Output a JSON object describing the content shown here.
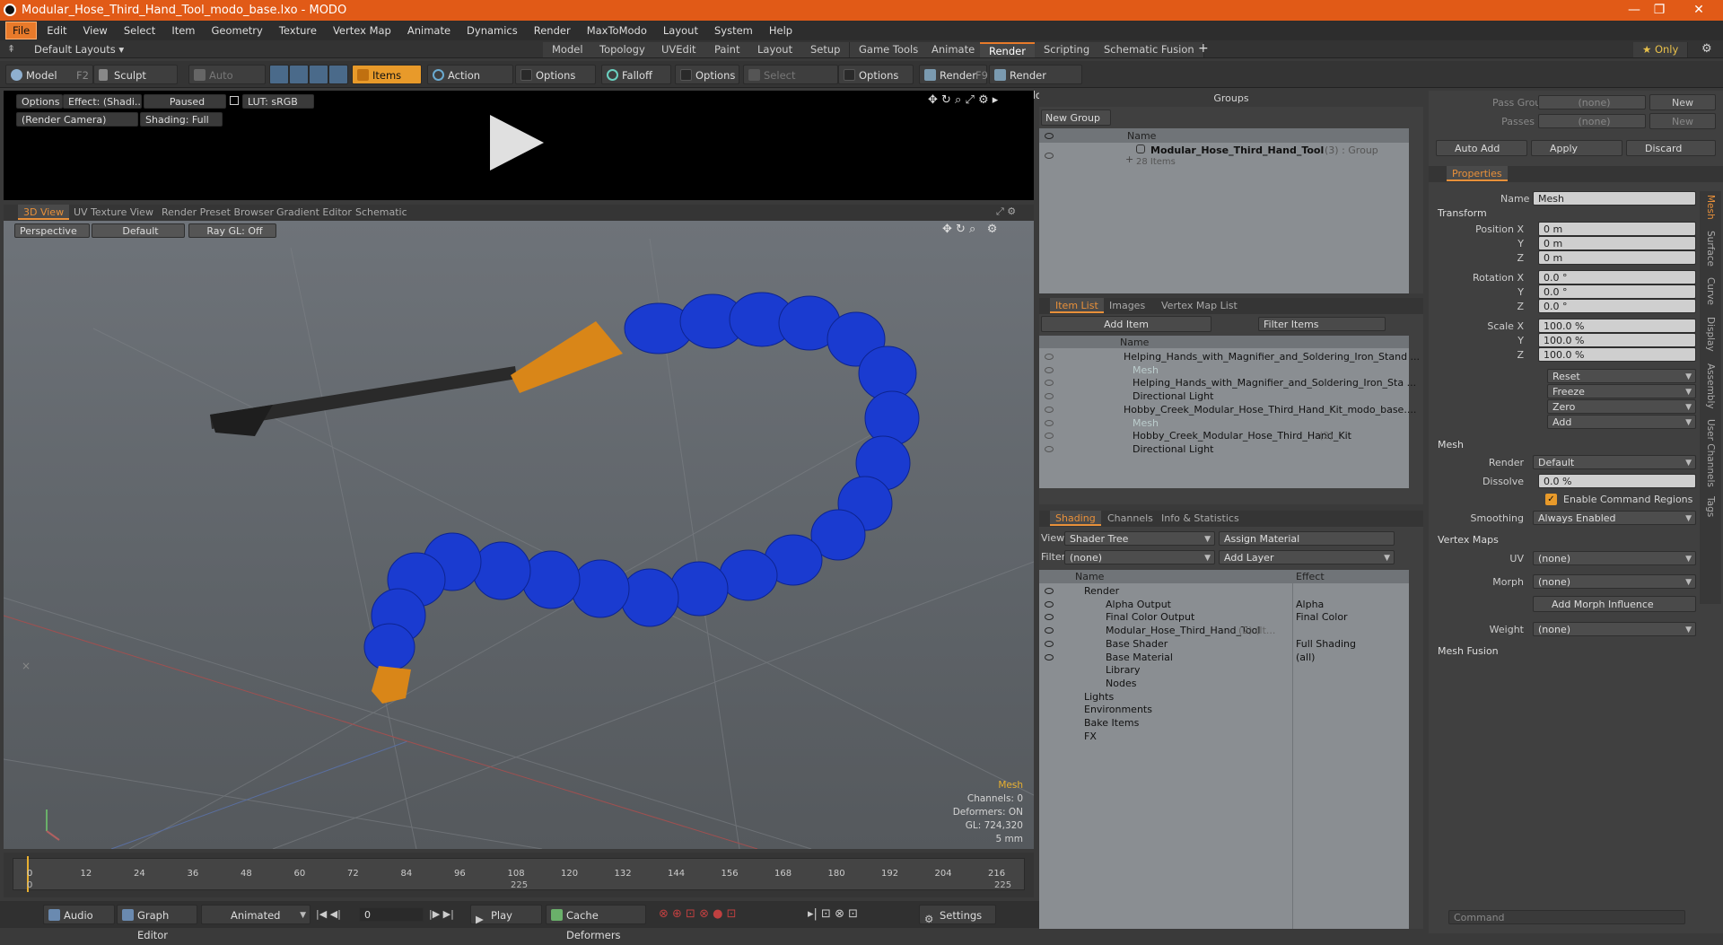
{
  "window": {
    "title": "Modular_Hose_Third_Hand_Tool_modo_base.lxo - MODO",
    "min": "—",
    "max": "❐",
    "close": "✕"
  },
  "menu": [
    "File",
    "Edit",
    "View",
    "Select",
    "Item",
    "Geometry",
    "Texture",
    "Vertex Map",
    "Animate",
    "Dynamics",
    "Render",
    "MaxToModo",
    "Layout",
    "System",
    "Help"
  ],
  "layouts": {
    "label": "Default Layouts ▾",
    "tabs": [
      "Model",
      "Topology",
      "UVEdit",
      "Paint",
      "Layout",
      "Setup",
      "Game Tools",
      "Animate",
      "Render",
      "Scripting",
      "Schematic Fusion"
    ],
    "selected": "Render",
    "plus": "+",
    "only": "★  Only"
  },
  "toolbar": {
    "model": "Model",
    "model_key": "F2",
    "sculpt": "Sculpt",
    "auto_select": "Auto Select",
    "items": "Items",
    "action_center": "Action Center",
    "options1": "Options",
    "falloff": "Falloff",
    "options2": "Options",
    "select_through": "Select Through",
    "options3": "Options",
    "render": "Render",
    "render_key": "F9",
    "render_window": "Render Window"
  },
  "preview": {
    "options": "Options",
    "effect": "Effect: (Shadi...",
    "paused": "Paused",
    "lut": "LUT: sRGB",
    "camera": "(Render Camera)",
    "shading": "Shading: Full"
  },
  "viewport_tabs": [
    "3D View",
    "UV Texture View",
    "Render Preset Browser",
    "Gradient Editor",
    "Schematic"
  ],
  "viewport": {
    "perspective": "Perspective",
    "default": "Default",
    "raygl": "Ray GL: Off",
    "info": [
      "Mesh",
      "Channels: 0",
      "Deformers: ON",
      "GL: 724,320",
      "5 mm"
    ]
  },
  "timeline": {
    "ticks": [
      "0",
      "12",
      "24",
      "36",
      "48",
      "60",
      "72",
      "84",
      "96",
      "108",
      "120",
      "132",
      "144",
      "156",
      "168",
      "180",
      "192",
      "204",
      "216"
    ],
    "sub_start": "0",
    "sub_mid": "225",
    "sub_end": "225"
  },
  "bottombar": {
    "audio": "Audio",
    "graph_editor": "Graph Editor",
    "animated": "Animated",
    "frame": "0",
    "play": "Play",
    "cache": "Cache Deformers",
    "settings": "Settings"
  },
  "groups": {
    "title": "Groups",
    "new_group": "New Group",
    "col_name": "Name",
    "item_name": "Modular_Hose_Third_Hand_Tool",
    "item_count": "(3) : Group",
    "item_sub": "28 Items"
  },
  "itemlist": {
    "tabs": [
      "Item List",
      "Images",
      "Vertex Map List"
    ],
    "add_item": "Add Item",
    "filter": "Filter Items",
    "col_name": "Name",
    "rows": [
      {
        "label": "Helping_Hands_with_Magnifier_and_Soldering_Iron_Stand ...",
        "indent": 0,
        "dim": false
      },
      {
        "label": "Mesh",
        "indent": 1,
        "dim": true
      },
      {
        "label": "Helping_Hands_with_Magnifier_and_Soldering_Iron_Sta ...",
        "indent": 1,
        "dim": false
      },
      {
        "label": "Directional Light",
        "indent": 1,
        "dim": false
      },
      {
        "label": "Hobby_Creek_Modular_Hose_Third_Hand_Kit_modo_base....",
        "indent": 0,
        "dim": false
      },
      {
        "label": "Mesh",
        "indent": 1,
        "dim": true
      },
      {
        "label": "Hobby_Creek_Modular_Hose_Third_Hand_Kit",
        "indent": 1,
        "dim": false,
        "count": "(2)"
      },
      {
        "label": "Directional Light",
        "indent": 1,
        "dim": false
      }
    ]
  },
  "shading": {
    "tabs": [
      "Shading",
      "Channels",
      "Info & Statistics"
    ],
    "view_label": "View",
    "view": "Shader Tree",
    "assign": "Assign Material",
    "filter_label": "Filter",
    "filter": "(none)",
    "add_layer": "Add Layer",
    "col_name": "Name",
    "col_effect": "Effect",
    "rows": [
      {
        "name": "Render",
        "effect": "",
        "indent": 0
      },
      {
        "name": "Alpha Output",
        "effect": "Alpha",
        "indent": 1
      },
      {
        "name": "Final Color Output",
        "effect": "Final Color",
        "indent": 1
      },
      {
        "name": "Modular_Hose_Third_Hand_Tool",
        "effect": "",
        "indent": 1,
        "count": "(2) (It..."
      },
      {
        "name": "Base Shader",
        "effect": "Full Shading",
        "indent": 1
      },
      {
        "name": "Base Material",
        "effect": "(all)",
        "indent": 1
      },
      {
        "name": "Library",
        "effect": "",
        "indent": 1
      },
      {
        "name": "Nodes",
        "effect": "",
        "indent": 1
      },
      {
        "name": "Lights",
        "effect": "",
        "indent": 0
      },
      {
        "name": "Environments",
        "effect": "",
        "indent": 0
      },
      {
        "name": "Bake Items",
        "effect": "",
        "indent": 0
      },
      {
        "name": "FX",
        "effect": "",
        "indent": 0
      }
    ]
  },
  "props": {
    "pass_groups": "Pass Groups",
    "passes": "Passes",
    "none": "(none)",
    "new": "New",
    "auto_add": "Auto Add",
    "apply": "Apply",
    "discard": "Discard",
    "tab": "Properties",
    "name_label": "Name",
    "name": "Mesh",
    "transform": "Transform",
    "pos_label": "Position X",
    "rot_label": "Rotation X",
    "scale_label": "Scale X",
    "y": "Y",
    "z": "Z",
    "pos": [
      "0 m",
      "0 m",
      "0 m"
    ],
    "rot": [
      "0.0 °",
      "0.0 °",
      "0.0 °"
    ],
    "scale": [
      "100.0 %",
      "100.0 %",
      "100.0 %"
    ],
    "reset": "Reset",
    "freeze": "Freeze",
    "zero": "Zero",
    "add": "Add",
    "mesh": "Mesh",
    "render_label": "Render",
    "render": "Default",
    "dissolve_label": "Dissolve",
    "dissolve": "0.0 %",
    "enable_cmd": "Enable Command Regions",
    "smoothing_label": "Smoothing",
    "smoothing": "Always Enabled",
    "vertex_maps": "Vertex Maps",
    "uv_label": "UV",
    "morph_label": "Morph",
    "add_morph": "Add Morph Influence",
    "weight_label": "Weight",
    "mesh_fusion": "Mesh Fusion",
    "command": "Command",
    "side_tabs": [
      "Mesh",
      "Surface",
      "Curve",
      "Display",
      "Assembly",
      "User Channels",
      "Tags"
    ]
  }
}
